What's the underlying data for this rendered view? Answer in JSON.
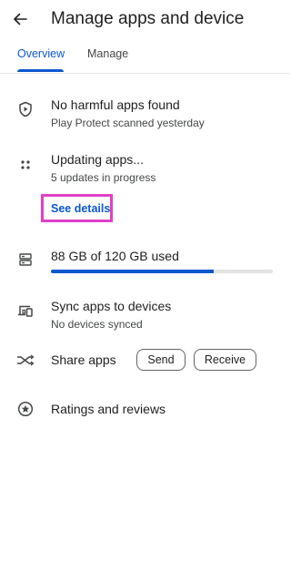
{
  "header": {
    "title": "Manage apps and device"
  },
  "tabs": [
    {
      "label": "Overview",
      "active": true
    },
    {
      "label": "Manage",
      "active": false
    }
  ],
  "play_protect": {
    "title": "No harmful apps found",
    "subtitle": "Play Protect scanned yesterday",
    "icon": "shield-play-icon"
  },
  "updates": {
    "title": "Updating apps...",
    "subtitle": "5 updates in progress",
    "link": "See details",
    "icon": "dots-grid-icon"
  },
  "storage": {
    "title": "88 GB of 120 GB used",
    "used_fraction": 0.733,
    "icon": "storage-icon"
  },
  "sync": {
    "title": "Sync apps to devices",
    "subtitle": "No devices synced",
    "icon": "devices-icon"
  },
  "share": {
    "title": "Share apps",
    "send_label": "Send",
    "receive_label": "Receive",
    "icon": "share-swap-icon"
  },
  "ratings": {
    "title": "Ratings and reviews",
    "icon": "star-circle-icon"
  },
  "colors": {
    "accent": "#0b57d0",
    "highlight": "#e040c8"
  }
}
